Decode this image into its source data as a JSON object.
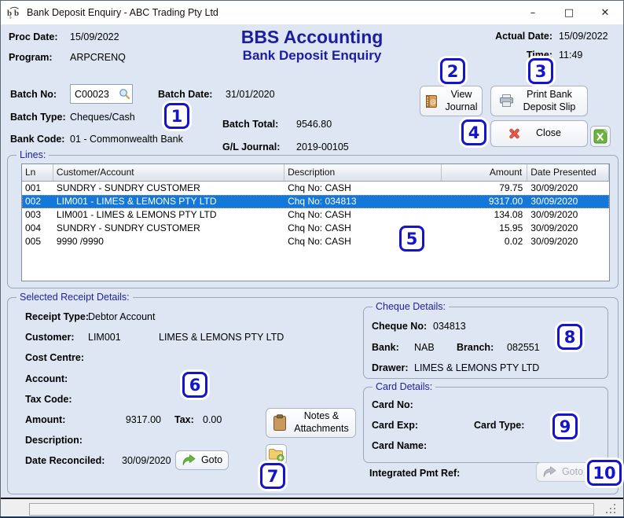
{
  "window": {
    "icon_text": "bbs",
    "title": "Bank Deposit Enquiry - ABC Trading Pty Ltd",
    "controls": {
      "minimize": "–",
      "maximize": "□",
      "close": "✕"
    }
  },
  "header": {
    "proc_date_label": "Proc Date:",
    "proc_date": "15/09/2022",
    "program_label": "Program:",
    "program": "ARPCRENQ",
    "app_title": "BBS Accounting",
    "screen_title": "Bank Deposit Enquiry",
    "actual_date_label": "Actual Date:",
    "actual_date": "15/09/2022",
    "time_label": "Time:",
    "time": "11:49"
  },
  "batch": {
    "batch_no_label": "Batch No:",
    "batch_no": "C00023",
    "batch_date_label": "Batch Date:",
    "batch_date": "31/01/2020",
    "batch_type_label": "Batch Type:",
    "batch_type": "Cheques/Cash",
    "batch_total_label": "Batch Total:",
    "batch_total": "9546.80",
    "bank_code_label": "Bank Code:",
    "bank_code": "01 - Commonwealth Bank",
    "gl_journal_label": "G/L Journal:",
    "gl_journal": "2019-00105"
  },
  "actions": {
    "view_journal": "View Journal",
    "print_deposit_slip": "Print Bank Deposit Slip",
    "close": "Close"
  },
  "lines": {
    "legend": "Lines:",
    "columns": [
      "Ln",
      "Customer/Account",
      "Description",
      "Amount",
      "Date Presented"
    ],
    "rows": [
      {
        "ln": "001",
        "customer": "SUNDRY - SUNDRY CUSTOMER",
        "description": "Chq No: CASH",
        "amount": "79.75",
        "date_presented": "30/09/2020",
        "selected": false
      },
      {
        "ln": "002",
        "customer": "LIM001 - LIMES & LEMONS PTY LTD",
        "description": "Chq No: 034813",
        "amount": "9317.00",
        "date_presented": "30/09/2020",
        "selected": true
      },
      {
        "ln": "003",
        "customer": "LIM001 - LIMES & LEMONS PTY LTD",
        "description": "Chq No: CASH",
        "amount": "134.08",
        "date_presented": "30/09/2020",
        "selected": false
      },
      {
        "ln": "004",
        "customer": "SUNDRY - SUNDRY CUSTOMER",
        "description": "Chq No: CASH",
        "amount": "15.95",
        "date_presented": "30/09/2020",
        "selected": false
      },
      {
        "ln": "005",
        "customer": "9990  /9990",
        "description": "Chq No: CASH",
        "amount": "0.02",
        "date_presented": "30/09/2020",
        "selected": false
      }
    ]
  },
  "receipt": {
    "legend": "Selected Receipt Details:",
    "receipt_type_label": "Receipt Type:",
    "receipt_type": "Debtor Account",
    "customer_label": "Customer:",
    "customer_code": "LIM001",
    "customer_name": "LIMES & LEMONS PTY LTD",
    "cost_centre_label": "Cost Centre:",
    "account_label": "Account:",
    "tax_code_label": "Tax Code:",
    "amount_label": "Amount:",
    "amount": "9317.00",
    "tax_label": "Tax:",
    "tax": "0.00",
    "description_label": "Description:",
    "date_reconciled_label": "Date Reconciled:",
    "date_reconciled": "30/09/2020",
    "goto_label": "Goto",
    "notes_button": "Notes & Attachments"
  },
  "cheque": {
    "legend": "Cheque Details:",
    "cheque_no_label": "Cheque No:",
    "cheque_no": "034813",
    "bank_label": "Bank:",
    "bank": "NAB",
    "branch_label": "Branch:",
    "branch": "082551",
    "drawer_label": "Drawer:",
    "drawer": "LIMES & LEMONS PTY LTD"
  },
  "card": {
    "legend": "Card Details:",
    "card_no_label": "Card No:",
    "card_exp_label": "Card Exp:",
    "card_type_label": "Card Type:",
    "card_name_label": "Card Name:"
  },
  "integrated": {
    "label": "Integrated Pmt Ref:",
    "goto_label": "Goto"
  },
  "callouts": [
    "1",
    "2",
    "3",
    "4",
    "5",
    "6",
    "7",
    "8",
    "9",
    "10"
  ],
  "colors": {
    "accent_navy": "#1d1d9f",
    "selection_blue": "#1478da",
    "callout_blue": "#1414cc",
    "client_bg": "#dde6f2"
  }
}
